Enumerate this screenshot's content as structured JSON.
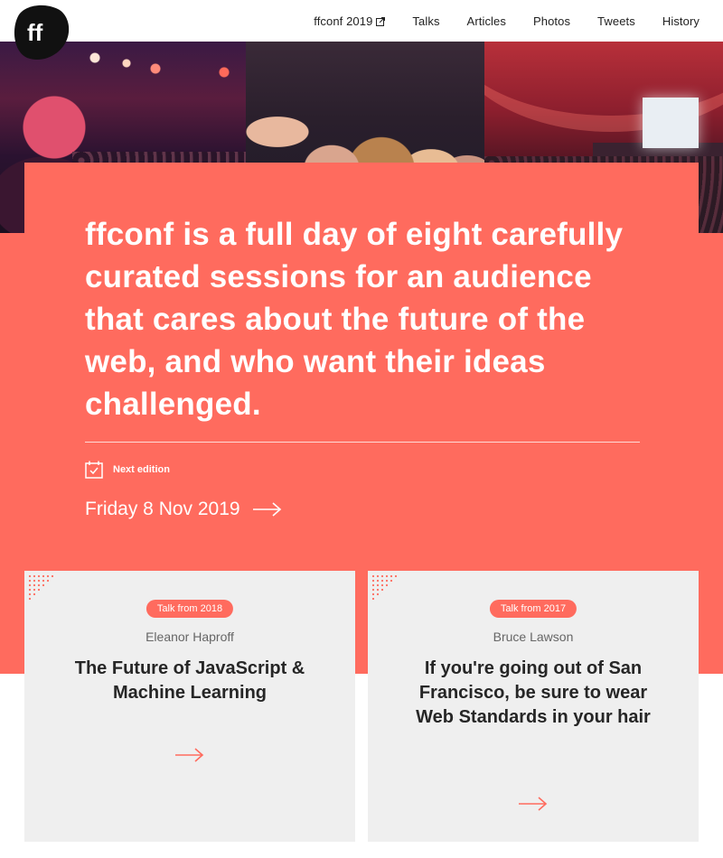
{
  "header": {
    "logo_text": "ff",
    "nav": [
      {
        "label": "ffconf 2019",
        "external": true
      },
      {
        "label": "Talks"
      },
      {
        "label": "Articles"
      },
      {
        "label": "Photos"
      },
      {
        "label": "Tweets"
      },
      {
        "label": "History"
      }
    ]
  },
  "photos": [
    {
      "icon": "audience-photo"
    },
    {
      "icon": "attendees-laughing-photo"
    },
    {
      "icon": "theatre-stage-photo"
    }
  ],
  "hero": {
    "statement": "ffconf is a full day of eight carefully curated sessions for an audience that cares about the future of the web, and who want their ideas challenged.",
    "next_edition_label": "Next edition",
    "date": "Friday 8 Nov 2019"
  },
  "cards": [
    {
      "badge": "Talk from 2018",
      "speaker": "Eleanor Haproff",
      "title": "The Future of JavaScript & Machine Learning"
    },
    {
      "badge": "Talk from 2017",
      "speaker": "Bruce Lawson",
      "title": "If you're going out of San Francisco, be sure to wear Web Standards in your hair"
    }
  ],
  "colors": {
    "accent": "#ff6b5e",
    "card_bg": "#efefef",
    "text_dark": "#262626"
  }
}
